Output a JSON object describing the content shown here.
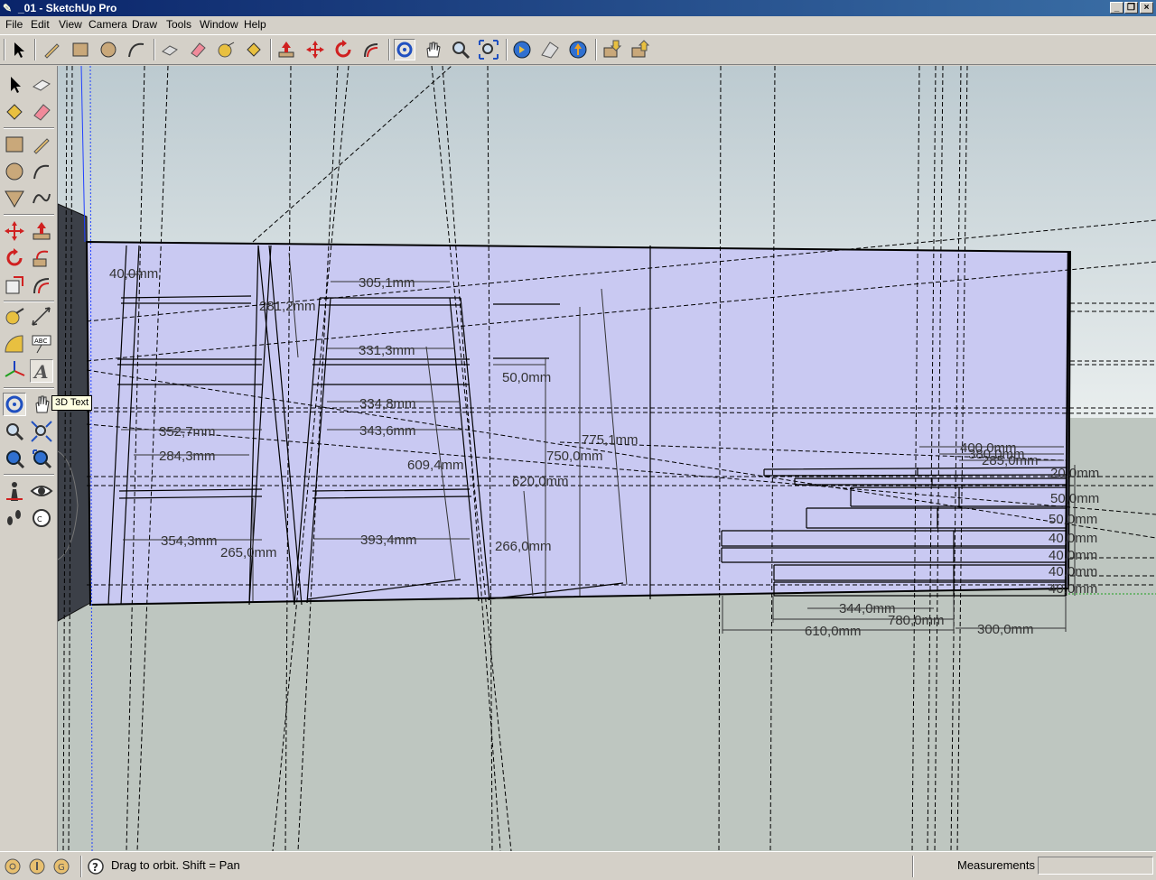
{
  "window": {
    "title": "_01 - SketchUp Pro"
  },
  "menu": {
    "items": [
      "File",
      "Edit",
      "View",
      "Camera",
      "Draw",
      "Tools",
      "Window",
      "Help"
    ]
  },
  "tooltip": {
    "text": "3D Text"
  },
  "status": {
    "hint": "Drag to orbit.  Shift = Pan",
    "measurements_label": "Measurements",
    "measurements_value": ""
  },
  "dims": [
    "40,0mm",
    "281,2mm",
    "305,1mm",
    "331,3mm",
    "50,0mm",
    "334,8mm",
    "343,6mm",
    "352,7mm",
    "284,3mm",
    "775,1mm",
    "750,0mm",
    "609,4mm",
    "620,0mm",
    "354,3mm",
    "265,0mm",
    "393,4mm",
    "266,0mm",
    "400,0mm",
    "380,0mm",
    "285,0mm",
    "20,0mm",
    "50,0mm",
    "50,0mm",
    "40,0mm",
    "40,0mm",
    "40,0mm",
    "40,0mm",
    "344,0mm",
    "780,0mm",
    "610,0mm",
    "300,0mm"
  ]
}
